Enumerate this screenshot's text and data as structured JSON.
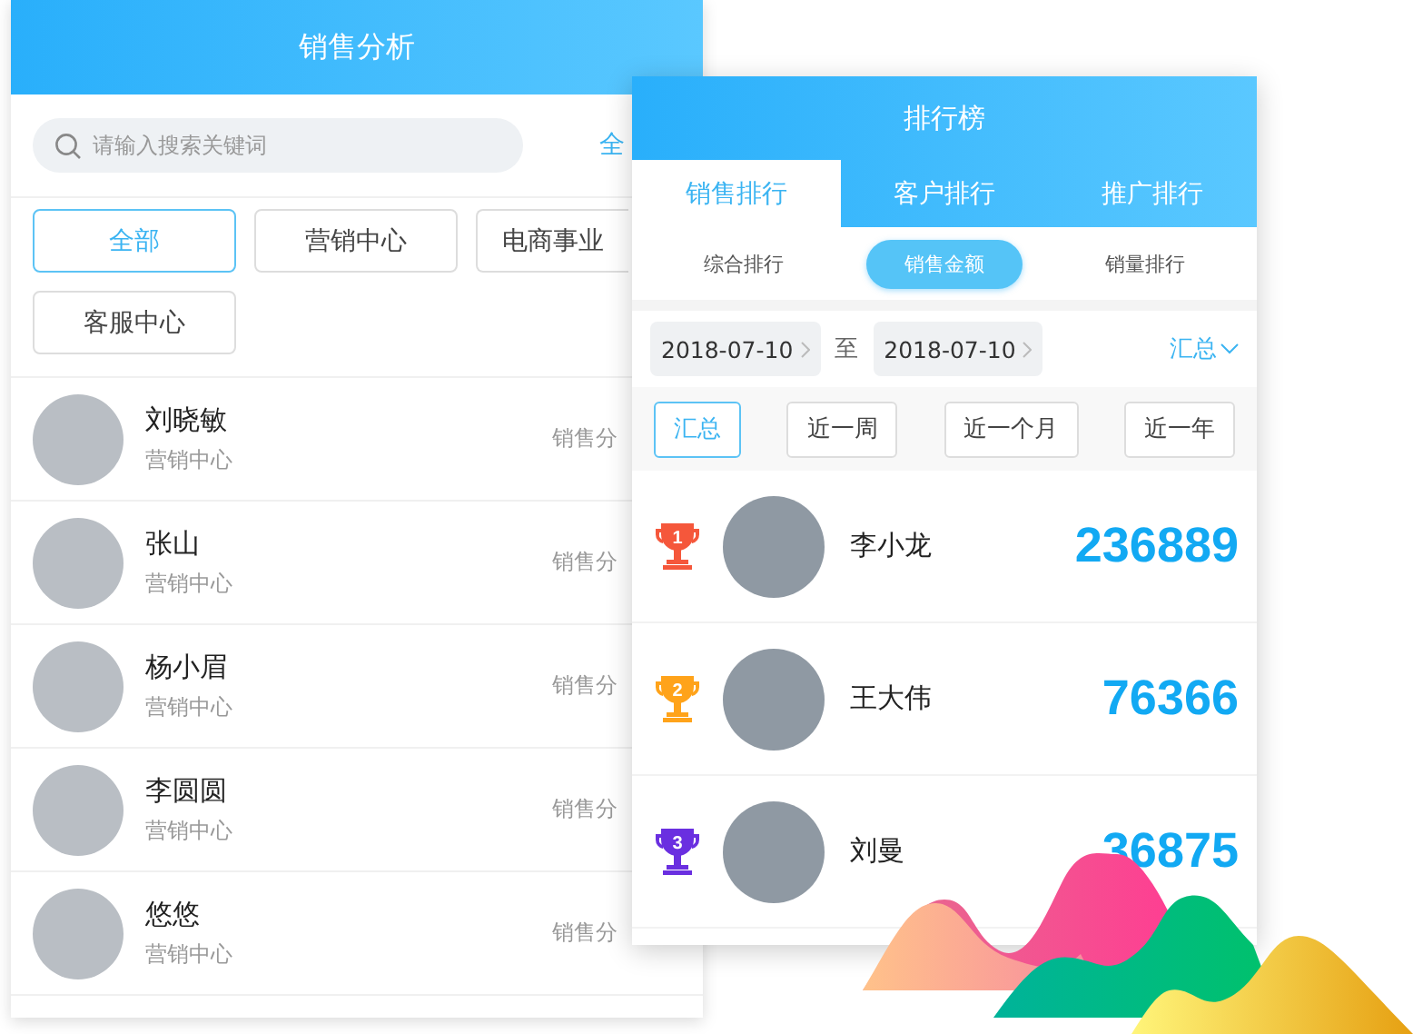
{
  "list_screen": {
    "title": "销售分析",
    "search": {
      "placeholder": "请输入搜索关键词"
    },
    "filter_link": "全",
    "departments": [
      {
        "label": "全部",
        "selected": true
      },
      {
        "label": "营销中心",
        "selected": false
      },
      {
        "label": "电商事业",
        "selected": false
      },
      {
        "label": "客服中心",
        "selected": false
      }
    ],
    "people": [
      {
        "name": "刘晓敏",
        "department": "营销中心",
        "action": "销售分"
      },
      {
        "name": "张山",
        "department": "营销中心",
        "action": "销售分"
      },
      {
        "name": "杨小眉",
        "department": "营销中心",
        "action": "销售分"
      },
      {
        "name": "李圆圆",
        "department": "营销中心",
        "action": "销售分"
      },
      {
        "name": "悠悠",
        "department": "营销中心",
        "action": "销售分"
      }
    ]
  },
  "ranking_screen": {
    "title": "排行榜",
    "tabs": [
      {
        "label": "销售排行",
        "selected": true
      },
      {
        "label": "客户排行",
        "selected": false
      },
      {
        "label": "推广排行",
        "selected": false
      }
    ],
    "sub_tabs": [
      {
        "label": "综合排行",
        "selected": false
      },
      {
        "label": "销售金额",
        "selected": true
      },
      {
        "label": "销量排行",
        "selected": false
      }
    ],
    "date_from": "2018-07-10",
    "separator": "至",
    "date_to": "2018-07-10",
    "mode": "汇总",
    "periods": [
      {
        "label": "汇总",
        "selected": true
      },
      {
        "label": "近一周",
        "selected": false
      },
      {
        "label": "近一个月",
        "selected": false
      },
      {
        "label": "近一年",
        "selected": false
      }
    ],
    "rankings": [
      {
        "rank": "1",
        "color": "#f5573b",
        "name": "李小龙",
        "amount": "236889"
      },
      {
        "rank": "2",
        "color": "#ffa31a",
        "name": "王大伟",
        "amount": "76366"
      },
      {
        "rank": "3",
        "color": "#6a2fe0",
        "name": "刘曼",
        "amount": "36875"
      }
    ]
  }
}
